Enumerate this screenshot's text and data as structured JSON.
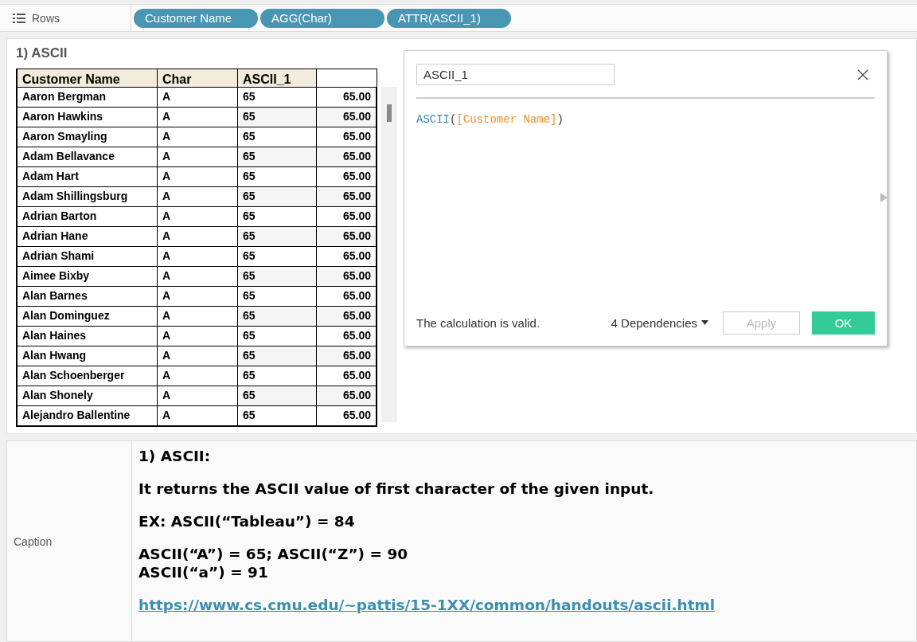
{
  "shelf": {
    "label": "Rows",
    "pills": [
      "Customer Name",
      "AGG(Char)",
      "ATTR(ASCII_1)"
    ]
  },
  "sheet": {
    "title": "1) ASCII",
    "columns": [
      "Customer Name",
      "Char",
      "ASCII_1"
    ],
    "rows": [
      {
        "name": "Aaron Bergman",
        "char": "A",
        "ascii": "65",
        "value": "65.00"
      },
      {
        "name": "Aaron Hawkins",
        "char": "A",
        "ascii": "65",
        "value": "65.00"
      },
      {
        "name": "Aaron Smayling",
        "char": "A",
        "ascii": "65",
        "value": "65.00"
      },
      {
        "name": "Adam Bellavance",
        "char": "A",
        "ascii": "65",
        "value": "65.00"
      },
      {
        "name": "Adam Hart",
        "char": "A",
        "ascii": "65",
        "value": "65.00"
      },
      {
        "name": "Adam Shillingsburg",
        "char": "A",
        "ascii": "65",
        "value": "65.00"
      },
      {
        "name": "Adrian Barton",
        "char": "A",
        "ascii": "65",
        "value": "65.00"
      },
      {
        "name": "Adrian Hane",
        "char": "A",
        "ascii": "65",
        "value": "65.00"
      },
      {
        "name": "Adrian Shami",
        "char": "A",
        "ascii": "65",
        "value": "65.00"
      },
      {
        "name": "Aimee Bixby",
        "char": "A",
        "ascii": "65",
        "value": "65.00"
      },
      {
        "name": "Alan Barnes",
        "char": "A",
        "ascii": "65",
        "value": "65.00"
      },
      {
        "name": "Alan Dominguez",
        "char": "A",
        "ascii": "65",
        "value": "65.00"
      },
      {
        "name": "Alan Haines",
        "char": "A",
        "ascii": "65",
        "value": "65.00"
      },
      {
        "name": "Alan Hwang",
        "char": "A",
        "ascii": "65",
        "value": "65.00"
      },
      {
        "name": "Alan Schoenberger",
        "char": "A",
        "ascii": "65",
        "value": "65.00"
      },
      {
        "name": "Alan Shonely",
        "char": "A",
        "ascii": "65",
        "value": "65.00"
      },
      {
        "name": "Alejandro Ballentine",
        "char": "A",
        "ascii": "65",
        "value": "65.00"
      }
    ]
  },
  "dialog": {
    "name_value": "ASCII_1",
    "formula": [
      {
        "kind": "function",
        "text": "ASCII"
      },
      {
        "kind": "paren",
        "text": "("
      },
      {
        "kind": "field",
        "text": "[Customer Name]"
      },
      {
        "kind": "paren",
        "text": ")"
      }
    ],
    "status": "The calculation is valid.",
    "dependencies": "4 Dependencies",
    "apply": {
      "label": "Apply",
      "disabled": true
    },
    "ok": "OK"
  },
  "caption": {
    "label": "Caption",
    "paragraphs": [
      [
        "1) ASCII:"
      ],
      [
        "It returns the ASCII value of first character of the given input."
      ],
      [
        "EX: ASCII(“Tableau”) = 84"
      ],
      [
        "ASCII(“A”) = 65; ASCII(“Z”) = 90",
        "ASCII(“a”) = 91"
      ]
    ],
    "link": "https://www.cs.cmu.edu/~pattis/15-1XX/common/handouts/ascii.html"
  }
}
